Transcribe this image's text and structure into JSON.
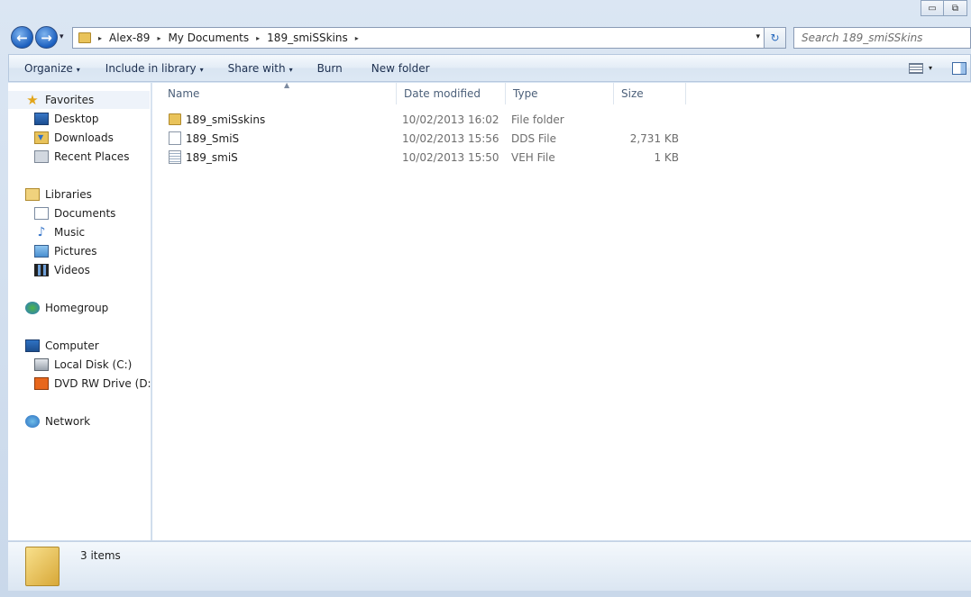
{
  "window": {
    "minimize_glyph": "▭",
    "maximize_glyph": "⧉"
  },
  "navigation": {
    "back_glyph": "←",
    "forward_glyph": "→",
    "recent_glyph": "▾"
  },
  "address": {
    "crumbs": [
      "Alex-89",
      "My Documents",
      "189_smiSSkins"
    ],
    "separator": "▸",
    "dropdown_glyph": "▾",
    "refresh_glyph": "↻"
  },
  "search": {
    "placeholder": "Search 189_smiSSkins"
  },
  "toolbar": {
    "organize": "Organize",
    "include_in_library": "Include in library",
    "share_with": "Share with",
    "burn": "Burn",
    "new_folder": "New folder",
    "caret": "▾",
    "view_caret": "▾"
  },
  "sidebar": {
    "favorites": {
      "label": "Favorites",
      "items": [
        {
          "label": "Desktop",
          "icon": "desktop-icon"
        },
        {
          "label": "Downloads",
          "icon": "downloads-icon"
        },
        {
          "label": "Recent Places",
          "icon": "recent-places-icon"
        }
      ]
    },
    "libraries": {
      "label": "Libraries",
      "items": [
        {
          "label": "Documents",
          "icon": "documents-icon"
        },
        {
          "label": "Music",
          "icon": "music-icon"
        },
        {
          "label": "Pictures",
          "icon": "pictures-icon"
        },
        {
          "label": "Videos",
          "icon": "videos-icon"
        }
      ]
    },
    "homegroup": {
      "label": "Homegroup"
    },
    "computer": {
      "label": "Computer",
      "items": [
        {
          "label": "Local Disk (C:)",
          "icon": "local-disk-icon"
        },
        {
          "label": "DVD RW Drive (D:) R",
          "icon": "dvd-drive-icon"
        }
      ]
    },
    "network": {
      "label": "Network"
    }
  },
  "columns": {
    "name": "Name",
    "date_modified": "Date modified",
    "type": "Type",
    "size": "Size",
    "sort_glyph": "▲"
  },
  "files": [
    {
      "name": "189_smiSskins",
      "date": "10/02/2013 16:02",
      "type": "File folder",
      "size": "",
      "icon": "folder-icon"
    },
    {
      "name": "189_SmiS",
      "date": "10/02/2013 15:56",
      "type": "DDS File",
      "size": "2,731 KB",
      "icon": "file-icon"
    },
    {
      "name": "189_smiS",
      "date": "10/02/2013 15:50",
      "type": "VEH File",
      "size": "1 KB",
      "icon": "document-icon"
    }
  ],
  "status": {
    "item_count": "3 items"
  },
  "colors": {
    "accent": "#1b5fbf",
    "folder": "#e9c35a",
    "frame": "#cfdcea"
  }
}
